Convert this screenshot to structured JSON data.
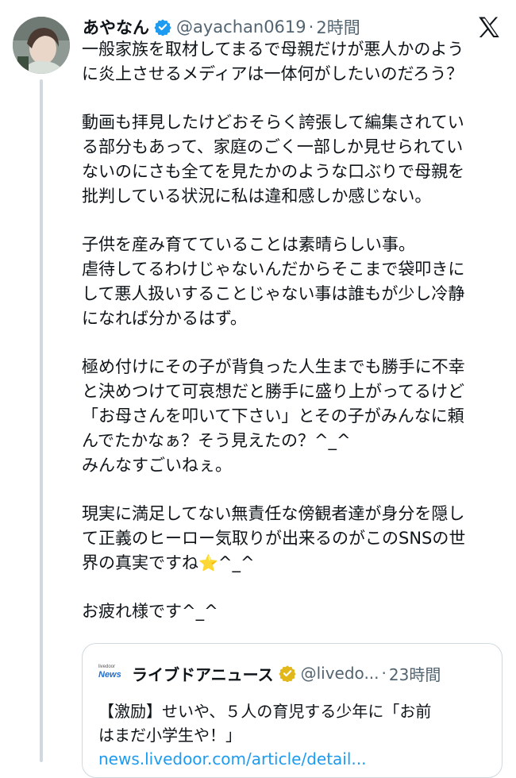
{
  "tweet": {
    "author_name": "あやなん",
    "handle": "@ayachan0619",
    "separator": "·",
    "time": "2時間",
    "lines": [
      "一般家族を取材してまるで母親だけが悪人かのよう",
      "に炎上させるメディアは一体何がしたいのだろう？",
      "",
      "動画も拝見したけどおそらく誇張して編集されてい",
      "る部分もあって、家庭のごく一部しか見せられてい",
      "ないのにさも全てを見たかのような口ぶりで母親を",
      "批判している状況に私は違和感しか感じない。",
      "",
      "子供を産み育てていることは素晴らしい事。",
      "虐待してるわけじゃないんだからそこまで袋叩きに",
      "して悪人扱いすることじゃない事は誰もが少し冷静",
      "になれば分かるはず。",
      "",
      "極め付けにその子が背負った人生までも勝手に不幸",
      "と決めつけて可哀想だと勝手に盛り上がってるけど",
      "「お母さんを叩いて下さい」とその子がみんなに頼",
      "んでたかなぁ？そう見えたの？^_^",
      "みんなすごいねぇ。",
      "",
      "現実に満足してない無責任な傍観者達が身分を隠し",
      "て正義のヒーロー気取りが出来るのがこのSNSの世",
      "",
      "",
      "お疲れ様です^_^"
    ],
    "line_22_before_star": "界の真実ですね",
    "line_22_star": "⭐",
    "line_22_after_star": "^_^"
  },
  "quote": {
    "logo_small": "livedoor",
    "logo_big": "News",
    "author_name": "ライブドアニュース",
    "handle": "@livedo...",
    "separator": "·",
    "time": "23時間",
    "line1": "【激励】せいや、５人の育児する少年に「お前",
    "line2": "はまだ小学生や！」",
    "link": "news.livedoor.com/article/detail..."
  },
  "colors": {
    "verified_blue": "#1d9bf0",
    "verified_gold": "#e2b719",
    "secondary_text": "#536471"
  }
}
